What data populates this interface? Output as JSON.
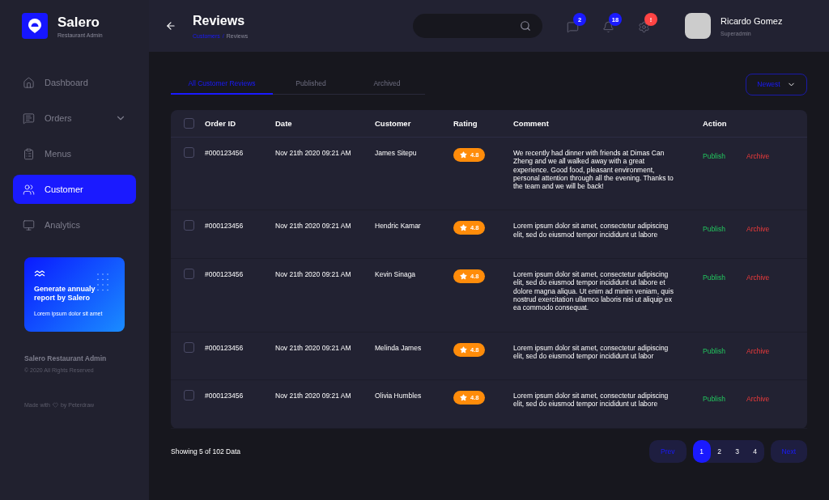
{
  "brand": {
    "name": "Salero",
    "subtitle": "Restaurant Admin"
  },
  "nav": [
    {
      "kind": "dashboard",
      "label": "Dashboard",
      "selected": false
    },
    {
      "kind": "orders",
      "label": "Orders",
      "selected": false,
      "expandable": true
    },
    {
      "kind": "menus",
      "label": "Menus",
      "selected": false
    },
    {
      "kind": "customer",
      "label": "Customer",
      "selected": true
    },
    {
      "kind": "analytics",
      "label": "Analytics",
      "selected": false
    }
  ],
  "promo": {
    "title": "Generate annualy report by Salero",
    "text": "Lorem ipsum dolor sit amet"
  },
  "footer": {
    "title": "Salero Restaurant Admin",
    "copyright": "© 2020 All Rights Reserved",
    "made_with": "Made with",
    "by": "by Peterdraw"
  },
  "header": {
    "title": "Reviews",
    "breadcrumb": [
      {
        "label": "Customers",
        "current": false
      },
      {
        "label": "Reviews",
        "current": true
      }
    ],
    "breadcrumb_separator": "/"
  },
  "notifications": [
    {
      "kind": "chat",
      "count": "2",
      "color": "#1a1aff"
    },
    {
      "kind": "bell",
      "count": "18",
      "color": "#1a1aff"
    },
    {
      "kind": "gear",
      "count": "!",
      "color": "#ff4444"
    }
  ],
  "user": {
    "name": "Ricardo Gomez",
    "role": "Superadmin"
  },
  "tabs": [
    {
      "label": "All Customer Reviews",
      "selected": true
    },
    {
      "label": "Published",
      "selected": false
    },
    {
      "label": "Archived",
      "selected": false
    }
  ],
  "sort": {
    "label": "Newest"
  },
  "table": {
    "columns": [
      "Order ID",
      "Date",
      "Customer",
      "Rating",
      "Comment",
      "Action"
    ],
    "header_checked": false,
    "rows": [
      {
        "checked": false,
        "order_id": "#000123456",
        "date": "Nov 21th 2020 09:21 AM",
        "customer": "James Sitepu",
        "rating": "4.8",
        "comment": "We recently had dinner with friends at Dimas Can Zheng and we all walked away with a great experience. Good food, pleasant environment, personal attention through all the evening. Thanks to the team and we will be back!",
        "publish": "Publish",
        "archive": "Archive"
      },
      {
        "checked": false,
        "order_id": "#000123456",
        "date": "Nov 21th 2020 09:21 AM",
        "customer": "Hendric Kamar",
        "rating": "4.8",
        "comment": "Lorem ipsum dolor sit amet, consectetur adipiscing elit, sed do eiusmod tempor incididunt ut labore",
        "publish": "Publish",
        "archive": "Archive"
      },
      {
        "checked": false,
        "order_id": "#000123456",
        "date": "Nov 21th 2020 09:21 AM",
        "customer": "Kevin Sinaga",
        "rating": "4.8",
        "comment": "Lorem ipsum dolor sit amet, consectetur adipiscing elit, sed do eiusmod tempor incididunt ut labore et dolore magna aliqua. Ut enim ad minim veniam, quis nostrud exercitation ullamco laboris nisi ut aliquip ex ea commodo consequat.",
        "publish": "Publish",
        "archive": "Archive"
      },
      {
        "checked": false,
        "order_id": "#000123456",
        "date": "Nov 21th 2020 09:21 AM",
        "customer": "Melinda James",
        "rating": "4.8",
        "comment": "Lorem ipsum dolor sit amet, consectetur adipiscing elit, sed do eiusmod tempor incididunt ut labor",
        "publish": "Publish",
        "archive": "Archive"
      },
      {
        "checked": false,
        "order_id": "#000123456",
        "date": "Nov 21th 2020 09:21 AM",
        "customer": "Olivia Humbles",
        "rating": "4.8",
        "comment": "Lorem ipsum dolor sit amet, consectetur adipiscing elit, sed do eiusmod tempor incididunt ut labore",
        "publish": "Publish",
        "archive": "Archive"
      }
    ]
  },
  "summary": "Showing 5 of 102 Data",
  "pagination": {
    "prev": "Prev",
    "next": "Next",
    "pages": [
      {
        "label": "1",
        "selected": true
      },
      {
        "label": "2",
        "selected": false
      },
      {
        "label": "3",
        "selected": false
      },
      {
        "label": "4",
        "selected": false
      }
    ]
  }
}
